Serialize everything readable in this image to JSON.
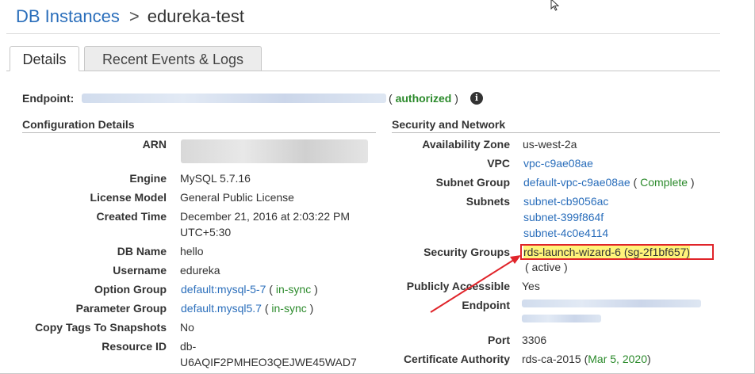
{
  "breadcrumb": {
    "parent": "DB Instances",
    "separator": ">",
    "current": "edureka-test"
  },
  "tabs": [
    {
      "label": "Details",
      "active": true
    },
    {
      "label": "Recent Events & Logs",
      "active": false
    }
  ],
  "endpoint": {
    "label": "Endpoint:",
    "status_open": "(",
    "status": "authorized",
    "status_close": ")",
    "info_icon": "i"
  },
  "config": {
    "title": "Configuration Details",
    "arn_label": "ARN",
    "engine_label": "Engine",
    "engine": "MySQL 5.7.16",
    "license_label": "License Model",
    "license": "General Public License",
    "created_label": "Created Time",
    "created_line1": "December 21, 2016 at 2:03:22 PM",
    "created_line2": "UTC+5:30",
    "dbname_label": "DB Name",
    "dbname": "hello",
    "username_label": "Username",
    "username": "edureka",
    "option_group_label": "Option Group",
    "option_group": "default:mysql-5-7",
    "option_group_status": "in-sync",
    "parameter_group_label": "Parameter Group",
    "parameter_group": "default.mysql5.7",
    "parameter_group_status": "in-sync",
    "copy_tags_label": "Copy Tags To Snapshots",
    "copy_tags": "No",
    "resource_id_label": "Resource ID",
    "resource_id_line1": "db-",
    "resource_id_line2": "U6AQIF2PMHEO3QEJWE45WAD7"
  },
  "security": {
    "title": "Security and Network",
    "az_label": "Availability Zone",
    "az": "us-west-2a",
    "vpc_label": "VPC",
    "vpc": "vpc-c9ae08ae",
    "subnet_group_label": "Subnet Group",
    "subnet_group": "default-vpc-c9ae08ae",
    "subnet_group_status": "Complete",
    "subnets_label": "Subnets",
    "subnets": [
      "subnet-cb9056ac",
      "subnet-399f864f",
      "subnet-4c0e4114"
    ],
    "sg_label": "Security Groups",
    "sg": "rds-launch-wizard-6 (sg-2f1bf657)",
    "sg_status": "( active )",
    "public_label": "Publicly Accessible",
    "public": "Yes",
    "endpoint_label": "Endpoint",
    "port_label": "Port",
    "port": "3306",
    "ca_label": "Certificate Authority",
    "ca": "rds-ca-2015",
    "ca_date": "Mar 5, 2020"
  },
  "colors": {
    "link": "#2a6ebb",
    "status_green": "#2b8a2b",
    "highlight_border": "#e0242a",
    "highlight_fill": "#fff47a"
  }
}
